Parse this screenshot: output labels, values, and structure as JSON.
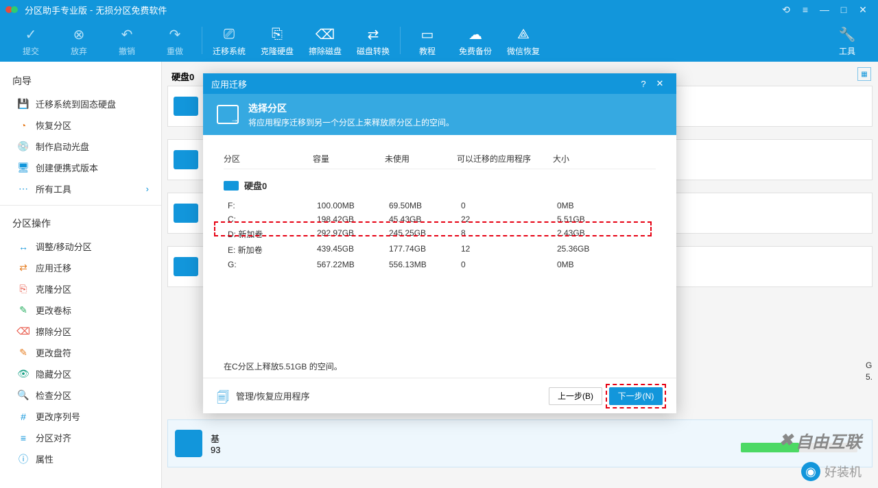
{
  "title": {
    "app": "分区助手专业版",
    "sub": "无损分区免费软件"
  },
  "winbtns": {
    "refresh": "⟲",
    "menu": "≡",
    "min": "—",
    "max": "□",
    "close": "✕"
  },
  "toolbar": {
    "commit": "提交",
    "discard": "放弃",
    "undo": "撤销",
    "redo": "重做",
    "migrate": "迁移系统",
    "clone": "克隆硬盘",
    "wipe": "擦除磁盘",
    "convert": "磁盘转换",
    "tutorial": "教程",
    "backup": "免费备份",
    "wechat": "微信恢复",
    "tools": "工具"
  },
  "sidebar": {
    "wizard_head": "向导",
    "wizard": [
      {
        "icon": "💾",
        "cls": "c-blue",
        "label": "迁移系统到固态硬盘"
      },
      {
        "icon": "◔",
        "cls": "c-orange",
        "label": "恢复分区"
      },
      {
        "icon": "💿",
        "cls": "c-red",
        "label": "制作启动光盘"
      },
      {
        "icon": "🖥",
        "cls": "c-blue",
        "label": "创建便携式版本"
      },
      {
        "icon": "⋯",
        "cls": "c-blue",
        "label": "所有工具",
        "chev": "›"
      }
    ],
    "ops_head": "分区操作",
    "ops": [
      {
        "icon": "↔",
        "cls": "c-blue",
        "label": "调整/移动分区"
      },
      {
        "icon": "⇄",
        "cls": "c-orange",
        "label": "应用迁移"
      },
      {
        "icon": "⎘",
        "cls": "c-red",
        "label": "克隆分区"
      },
      {
        "icon": "✎",
        "cls": "c-green",
        "label": "更改卷标"
      },
      {
        "icon": "⌫",
        "cls": "c-red",
        "label": "擦除分区"
      },
      {
        "icon": "✎",
        "cls": "c-orange",
        "label": "更改盘符"
      },
      {
        "icon": "👁",
        "cls": "c-teal",
        "label": "隐藏分区"
      },
      {
        "icon": "🔍",
        "cls": "c-orange",
        "label": "检查分区"
      },
      {
        "icon": "#",
        "cls": "c-blue",
        "label": "更改序列号"
      },
      {
        "icon": "≡",
        "cls": "c-blue",
        "label": "分区对齐"
      },
      {
        "icon": "ⓘ",
        "cls": "c-blue",
        "label": "属性"
      }
    ]
  },
  "content": {
    "disk0": "硬盘0",
    "base": "基",
    "num": "93",
    "g": "G",
    "five": "5."
  },
  "modal": {
    "title": "应用迁移",
    "header_title": "选择分区",
    "header_sub": "将应用程序迁移到另一个分区上来释放原分区上的空间。",
    "cols": {
      "c1": "分区",
      "c2": "容量",
      "c3": "未使用",
      "c4": "可以迁移的应用程序",
      "c5": "大小"
    },
    "disk_label": "硬盘0",
    "rows": [
      {
        "p": "F:",
        "cap": "100.00MB",
        "unused": "69.50MB",
        "apps": "0",
        "size": "0MB"
      },
      {
        "p": "C:",
        "cap": "198.42GB",
        "unused": "45.43GB",
        "apps": "22",
        "size": "5.51GB"
      },
      {
        "p": "D: 新加卷",
        "cap": "292.97GB",
        "unused": "245.25GB",
        "apps": "8",
        "size": "2.43GB"
      },
      {
        "p": "E: 新加卷",
        "cap": "439.45GB",
        "unused": "177.74GB",
        "apps": "12",
        "size": "25.36GB"
      },
      {
        "p": "G:",
        "cap": "567.22MB",
        "unused": "556.13MB",
        "apps": "0",
        "size": "0MB"
      }
    ],
    "status": "在C分区上释放5.51GB 的空间。",
    "manage": "管理/恢复应用程序",
    "back": "上一步(B)",
    "next": "下一步(N)"
  },
  "watermark": {
    "w1": "自由互联",
    "w2": "好装机"
  }
}
